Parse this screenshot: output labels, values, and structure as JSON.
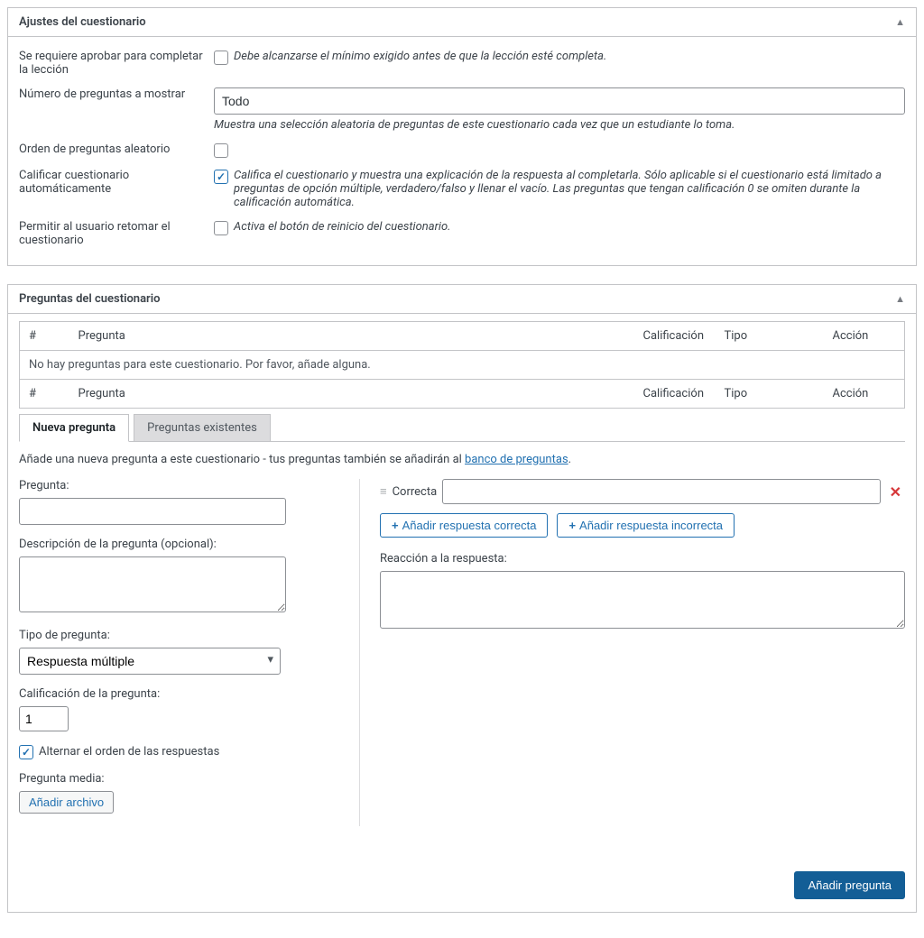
{
  "settings": {
    "title": "Ajustes del cuestionario",
    "pass_label": "Se requiere aprobar para completar la lección",
    "pass_help": "Debe alcanzarse el mínimo exigido antes de que la lección esté completa.",
    "num_label": "Número de preguntas a mostrar",
    "num_value": "Todo",
    "num_help": "Muestra una selección aleatoria de preguntas de este cuestionario cada vez que un estudiante lo toma.",
    "random_label": "Orden de preguntas aleatorio",
    "autograde_label": "Calificar cuestionario automáticamente",
    "autograde_help": "Califica el cuestionario y muestra una explicación de la respuesta al completarla. Sólo aplicable si el cuestionario está limitado a preguntas de opción múltiple, verdadero/falso y llenar el vacío. Las preguntas que tengan calificación 0 se omiten durante la calificación automática.",
    "reset_label": "Permitir al usuario retomar el cuestionario",
    "reset_help": "Activa el botón de reinicio del cuestionario."
  },
  "questions": {
    "title": "Preguntas del cuestionario",
    "cols": {
      "num": "#",
      "pregunta": "Pregunta",
      "cal": "Calificación",
      "tipo": "Tipo",
      "accion": "Acción"
    },
    "empty": "No hay preguntas para este cuestionario. Por favor, añade alguna.",
    "tabs": {
      "new": "Nueva pregunta",
      "existing": "Preguntas existentes"
    },
    "hint_pre": "Añade una nueva pregunta a este cuestionario - tus preguntas también se añadirán al ",
    "hint_link": "banco de preguntas",
    "hint_post": "."
  },
  "form": {
    "pregunta_label": "Pregunta:",
    "desc_label": "Descripción de la pregunta (opcional):",
    "tipo_label": "Tipo de pregunta:",
    "tipo_value": "Respuesta múltiple",
    "cal_label": "Calificación de la pregunta:",
    "cal_value": "1",
    "alternar": "Alternar el orden de las respuestas",
    "media_label": "Pregunta media:",
    "media_btn": "Añadir archivo"
  },
  "answers": {
    "correct_label": "Correcta",
    "add_correct": "Añadir respuesta correcta",
    "add_incorrect": "Añadir respuesta incorrecta",
    "feedback_label": "Reacción a la respuesta:"
  },
  "footer": {
    "add_question": "Añadir pregunta"
  }
}
